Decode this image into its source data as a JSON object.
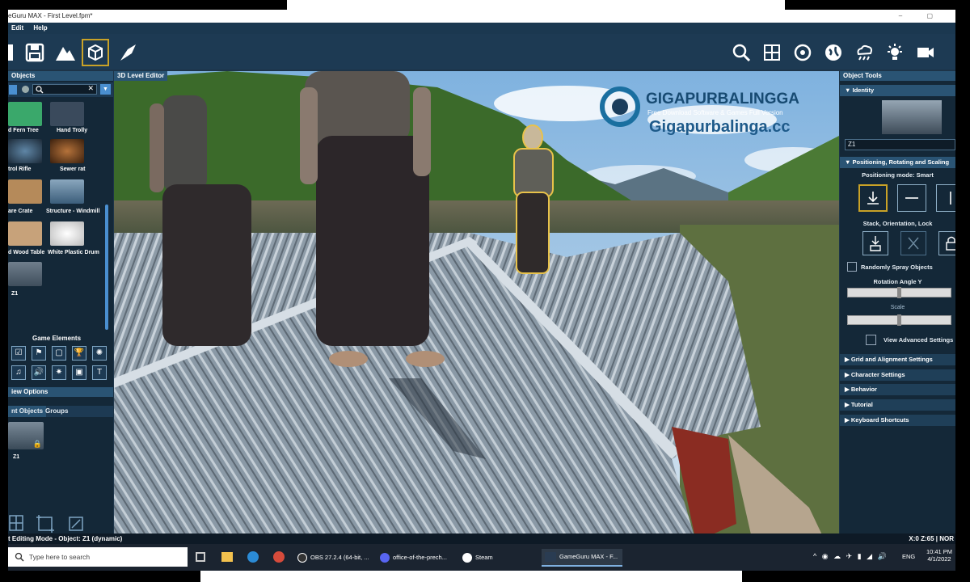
{
  "window": {
    "title": "eGuru MAX - First Level.fpm*",
    "controls": [
      "–",
      "▢"
    ]
  },
  "menu": [
    "Edit",
    "Help"
  ],
  "toolbar_left_icons": [
    "save-icon",
    "terrain-icon",
    "cube-icon",
    "rocket-icon"
  ],
  "toolbar_right_icons": [
    "search-object-icon",
    "map-icon",
    "target-icon",
    "globe-icon",
    "weather-icon",
    "light-icon",
    "camera-icon"
  ],
  "left": {
    "tab": "Objects",
    "search_placeholder": "",
    "objects": [
      {
        "label": "d Fern Tree",
        "color": "#3aa86b"
      },
      {
        "label": "Hand Trolly",
        "color": "#3a4a5c"
      },
      {
        "label": "trol Rifle",
        "color": "#2d3a48"
      },
      {
        "label": "Sewer rat",
        "color": "#7a4a22"
      },
      {
        "label": "are Crate",
        "color": "#b58a5a"
      },
      {
        "label": "Structure - Windmill",
        "color": "#3b5d7a"
      },
      {
        "label": "d Wood Table",
        "color": "#c7a27a"
      },
      {
        "label": "White Plastic Drum",
        "color": "#e6e6e6"
      },
      {
        "label": "Z1",
        "color": "#6f7e8c"
      }
    ],
    "game_elements_title": "Game Elements",
    "game_elements": [
      "☑",
      "⚑",
      "▢",
      "🏆",
      "✺",
      "♫",
      "🔊",
      "✷",
      "▣",
      "T"
    ],
    "view_options": "iew Options",
    "tabs": [
      "nt Objects",
      "Groups"
    ],
    "current_object": "Z1",
    "bottom_icons": [
      "grid-icon",
      "frame-icon",
      "edit-frame-icon"
    ]
  },
  "viewport": {
    "tab": "3D Level Editor",
    "watermark_title": "GIGAPURBALINGGA",
    "watermark_sub": "Free Download Software & Games Full Version",
    "watermark_url": "Gigapurbalinga.cc"
  },
  "right": {
    "tab": "Object Tools",
    "identity": "Identity",
    "name_value": "Z1",
    "positioning_header": "Positioning, Rotating and Scaling",
    "positioning_mode": "Positioning mode: Smart",
    "stack_label": "Stack, Orientation, Lock",
    "random_spray": "Randomly Spray Objects",
    "rotation_label": "Rotation Angle Y",
    "scale_label": "Scale",
    "rotation_level": 0.5,
    "scale_level": 0.5,
    "advanced": "View Advanced Settings",
    "sections": [
      "Grid and Alignment Settings",
      "Character Settings",
      "Behavior",
      "Tutorial",
      "Keyboard Shortcuts"
    ]
  },
  "status": {
    "left": "t Editing Mode - Object: Z1 (dynamic)",
    "right": "X:0 Z:65 | NOR"
  },
  "taskbar": {
    "search_placeholder": "Type here to search",
    "apps": [
      {
        "label": "OBS 27.2.4 (64-bit, ...",
        "color": "#333"
      },
      {
        "label": "office-of-the-prech...",
        "color": "#5865f2"
      },
      {
        "label": "Steam",
        "color": "#1b2838"
      },
      {
        "label": "GameGuru MAX - F...",
        "color": "#2a3c52"
      }
    ],
    "lang": "ENG",
    "time": "10:41 PM",
    "date": "4/1/2022"
  }
}
